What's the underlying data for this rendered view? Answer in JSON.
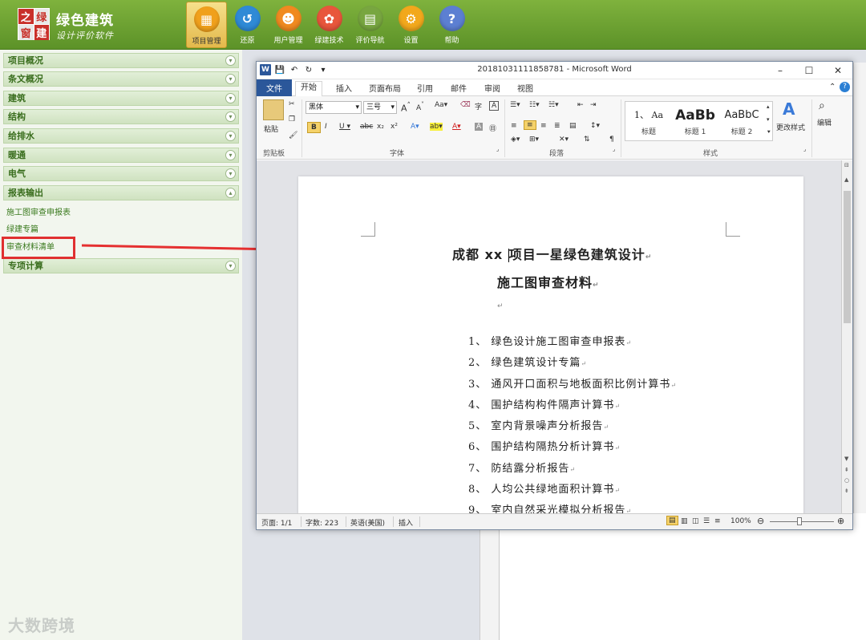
{
  "app": {
    "logo_chars": [
      "之",
      "绿",
      "窗",
      "建"
    ],
    "title": "绿色建筑",
    "subtitle": "设计评价软件"
  },
  "toolbar": [
    {
      "label": "项目管理",
      "icon": "project-icon",
      "color": "#f0a01c",
      "glyph": "▦",
      "active": true
    },
    {
      "label": "还原",
      "icon": "restore-icon",
      "color": "#2f8ad6",
      "glyph": "↺"
    },
    {
      "label": "用户管理",
      "icon": "user-icon",
      "color": "#f08a20",
      "glyph": "☻"
    },
    {
      "label": "绿建技术",
      "icon": "tech-icon",
      "color": "#e8563c",
      "glyph": "✿"
    },
    {
      "label": "评价导航",
      "icon": "nav-book-icon",
      "color": "#78a640",
      "glyph": "▤"
    },
    {
      "label": "设置",
      "icon": "settings-icon",
      "color": "#f2a81c",
      "glyph": "⚙"
    },
    {
      "label": "帮助",
      "icon": "help-icon",
      "color": "#5c7fd2",
      "glyph": "?"
    }
  ],
  "sidebar": {
    "sections": [
      "项目概况",
      "条文概况",
      "建筑",
      "结构",
      "给排水",
      "暖通",
      "电气",
      "报表输出"
    ],
    "report_items": [
      "施工图审查申报表",
      "绿建专篇",
      "审查材料清单"
    ],
    "last_section": "专项计算"
  },
  "watermark": "大数跨境",
  "word": {
    "title": "20181031111858781 - Microsoft Word",
    "tabs": [
      "开始",
      "插入",
      "页面布局",
      "引用",
      "邮件",
      "审阅",
      "视图"
    ],
    "file_tab": "文件",
    "ribbon": {
      "paste": "粘贴",
      "clipboard": "剪贴板",
      "font_name": "黑体",
      "font_size": "三号",
      "font_group": "字体",
      "para_group": "段落",
      "styles_group": "样式",
      "styles": [
        {
          "preview": "1、 Aa",
          "label": "标题"
        },
        {
          "preview": "AaBb",
          "label": "标题 1"
        },
        {
          "preview": "AaBbC",
          "label": "标题 2"
        }
      ],
      "change_styles": "更改样式",
      "edit": "编辑"
    },
    "document": {
      "title_line1_a": "成都 xx ",
      "title_line1_b": "项目一星绿色建筑设计",
      "title_line2": "施工图审查材料",
      "items": [
        "1、 绿色设计施工图审查申报表",
        "2、 绿色建筑设计专篇",
        "3、 通风开口面积与地板面积比例计算书",
        "4、 围护结构构件隔声计算书",
        "5、 室内背景噪声分析报告",
        "6、 围护结构隔热分析计算书",
        "7、 防结露分析报告",
        "8、 人均公共绿地面积计算书",
        "9、 室内自然采光模拟分析报告"
      ]
    },
    "status": {
      "page": "页面: 1/1",
      "words": "字数: 223",
      "language": "英语(美国)",
      "mode": "插入",
      "zoom": "100%"
    }
  }
}
